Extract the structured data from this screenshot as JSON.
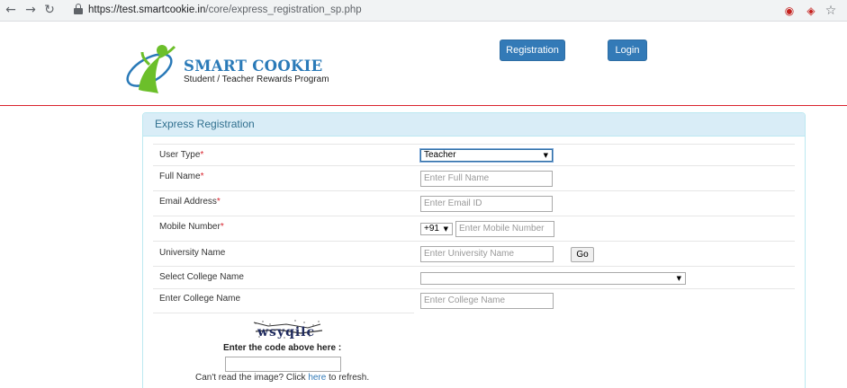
{
  "browser": {
    "back_icon": "←",
    "forward_icon": "→",
    "reload_icon": "↻",
    "url_host": "https://test.smartcookie.in",
    "url_path": "/core/express_registration_sp.php",
    "ext1_icon": "◉",
    "ext2_icon": "◈",
    "star_icon": "☆"
  },
  "header": {
    "brand": "SMART COOKIE",
    "tagline": "Student / Teacher Rewards Program",
    "registration_label": "Registration",
    "login_label": "Login"
  },
  "panel": {
    "title": "Express Registration"
  },
  "form": {
    "user_type_label": "User Type",
    "user_type_value": "Teacher",
    "full_name_label": "Full Name",
    "full_name_placeholder": "Enter Full Name",
    "email_label": "Email Address",
    "email_placeholder": "Enter Email ID",
    "mobile_label": "Mobile Number",
    "country_code": "+91",
    "mobile_placeholder": "Enter Mobile Number",
    "university_label": "University Name",
    "university_placeholder": "Enter University Name",
    "go_label": "Go",
    "select_college_label": "Select College Name",
    "select_college_value": "",
    "enter_college_label": "Enter College Name",
    "college_placeholder": "Enter College Name",
    "required_mark": "*",
    "caret": "▼"
  },
  "captcha": {
    "code": "wsyqilc",
    "prompt": "Enter the code above here :",
    "refresh_prefix": "Can't read the image? Click ",
    "refresh_link": "here",
    "refresh_suffix": " to refresh."
  },
  "colors": {
    "primary_button": "#337ab7",
    "brand_blue": "#2a7ab8",
    "brand_green": "#6cbf2a",
    "header_rule": "#d9232d",
    "panel_heading_bg": "#d9edf7"
  }
}
